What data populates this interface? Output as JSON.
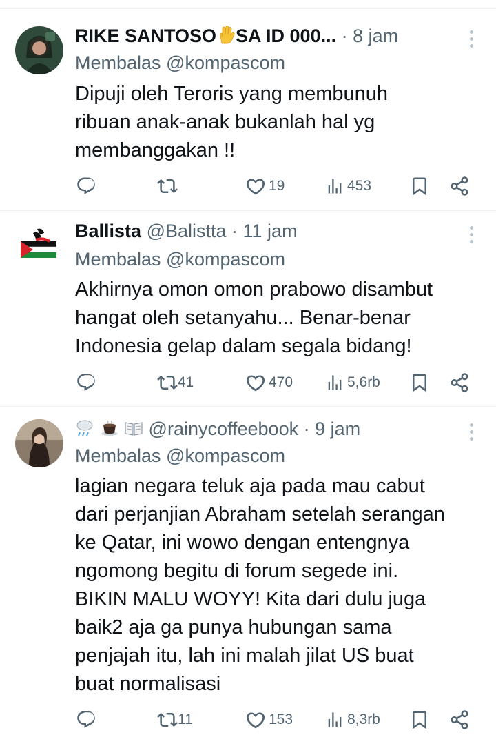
{
  "tweets": [
    {
      "name": "RIKE SANTOSO",
      "name_suffix": "SA ID 000...",
      "handle": "",
      "time": "· 8 jam",
      "reply_prefix": "Membalas ",
      "reply_to": "@kompascom",
      "text_lines": [
        "Dipuji oleh Teroris yang membunuh",
        "ribuan anak-anak bukanlah hal yg",
        "membanggakan !!"
      ],
      "stats": {
        "reply": "",
        "retweet": "",
        "like": "19",
        "views": "453"
      }
    },
    {
      "name": "Ballista",
      "handle": "@Balistta",
      "time": "· 11 jam",
      "reply_prefix": "Membalas ",
      "reply_to": "@kompascom",
      "text_lines": [
        "Akhirnya omon omon prabowo disambut",
        "hangat oleh setanyahu... Benar-benar",
        "Indonesia gelap dalam segala bidang!"
      ],
      "stats": {
        "reply": "",
        "retweet": "41",
        "like": "470",
        "views": "5,6rb"
      }
    },
    {
      "name": "",
      "handle": "@rainycoffeebook",
      "time": "· 9 jam",
      "reply_prefix": "Membalas ",
      "reply_to": "@kompascom",
      "text_lines": [
        "lagian negara teluk aja pada mau cabut",
        "dari perjanjian Abraham setelah serangan",
        "ke Qatar, ini wowo dengan entengnya",
        "ngomong begitu di forum segede ini.",
        "BIKIN MALU WOYY! Kita dari dulu juga",
        "baik2 aja ga punya hubungan sama",
        "penjajah itu, lah ini malah jilat US buat",
        "buat normalisasi"
      ],
      "stats": {
        "reply": "",
        "retweet": "11",
        "like": "153",
        "views": "8,3rb"
      }
    }
  ],
  "icons": {
    "reply": "reply-icon",
    "retweet": "retweet-icon",
    "like": "heart-icon",
    "views": "views-icon",
    "bookmark": "bookmark-icon",
    "share": "share-icon",
    "more": "more-options-icon"
  },
  "colors": {
    "text": "#0f1419",
    "secondary": "#536471",
    "divider": "#eff3f4"
  }
}
